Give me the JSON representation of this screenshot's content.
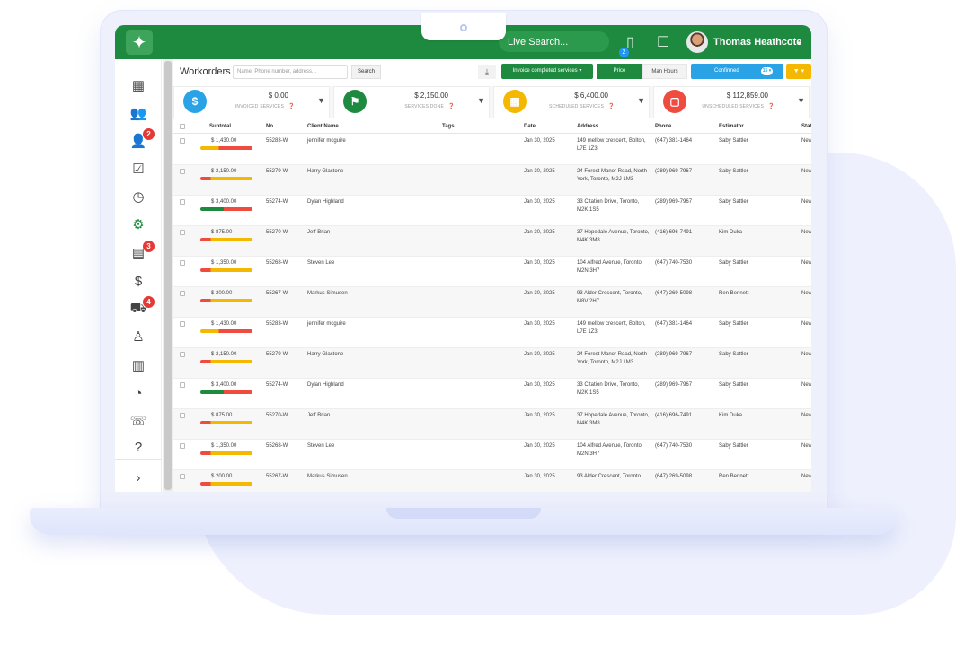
{
  "app": {
    "user_name": "Thomas Heathcote",
    "live_search_placeholder": "Live Search...",
    "phone_badge": "2",
    "colors": {
      "brand": "#1e8a3f",
      "accent_blue": "#29a3e6",
      "accent_yellow": "#f5b800",
      "badge_red": "#e53935"
    }
  },
  "sidebar": {
    "items": [
      {
        "name": "dashboard-icon",
        "glyph": "▦",
        "badge": ""
      },
      {
        "name": "users-icon",
        "glyph": "👥",
        "badge": ""
      },
      {
        "name": "add-user-icon",
        "glyph": "👤",
        "badge": "2"
      },
      {
        "name": "task-check-icon",
        "glyph": "☑",
        "badge": ""
      },
      {
        "name": "clock-icon",
        "glyph": "◷",
        "badge": ""
      },
      {
        "name": "gear-icon",
        "glyph": "⚙",
        "badge": ""
      },
      {
        "name": "calendar-icon",
        "glyph": "▤",
        "badge": "3"
      },
      {
        "name": "dollar-icon",
        "glyph": "$",
        "badge": ""
      },
      {
        "name": "truck-icon",
        "glyph": "⛟",
        "badge": "4"
      },
      {
        "name": "person-icon",
        "glyph": "♙",
        "badge": ""
      },
      {
        "name": "table-icon",
        "glyph": "▥",
        "badge": ""
      },
      {
        "name": "pie-chart-icon",
        "glyph": "◔",
        "badge": ""
      },
      {
        "name": "phone-icon",
        "glyph": "☏",
        "badge": ""
      },
      {
        "name": "help-icon",
        "glyph": "?",
        "badge": ""
      },
      {
        "name": "expand-chevron-icon",
        "glyph": "›",
        "badge": ""
      }
    ]
  },
  "toolbar": {
    "title": "Workorders",
    "search_placeholder": "Name, Phone number, address...",
    "search_label": "Search",
    "status_filter": "Invoice completed services ▾",
    "price_label": "Price",
    "hours_label": "Man Hours",
    "confirmed_label": "Confirmed",
    "confirmed_count": "15 ▾",
    "filter_label": "▼ ▾"
  },
  "summary": [
    {
      "amount": "$ 0.00",
      "label": "INVOICED SERVICES",
      "icon": "dollar-icon",
      "glyph": "$",
      "color": "#29a3e6"
    },
    {
      "amount": "$ 2,150.00",
      "label": "SERVICES DONE",
      "icon": "flag-icon",
      "glyph": "⚑",
      "color": "#1e8a3f"
    },
    {
      "amount": "$ 6,400.00",
      "label": "SCHEDULED SERVICES",
      "icon": "calendar-icon",
      "glyph": "▦",
      "color": "#f5b800"
    },
    {
      "amount": "$ 112,859.00",
      "label": "UNSCHEDULED SERVICES",
      "icon": "calendar-x-icon",
      "glyph": "▢",
      "color": "#ef4b3f"
    }
  ],
  "table": {
    "columns": [
      "Subtotal",
      "No",
      "Client Name",
      "Tags",
      "Date",
      "Address",
      "Phone",
      "Estimator",
      "Status"
    ],
    "rows": [
      {
        "subtotal": "$ 1,430.00",
        "no": "55283-W",
        "client": "jennifer mcguire",
        "date": "Jan 30, 2025",
        "address": "149 mellow crescent, Bolton, L7E 1Z3",
        "phone": "(647) 381-1464",
        "estimator": "Saby Sattler",
        "status": "New",
        "bar": "red"
      },
      {
        "subtotal": "$ 2,150.00",
        "no": "55279-W",
        "client": "Harry Glastone",
        "date": "Jan 30, 2025",
        "address": "24 Forest Manor Road, North York, Toronto, M2J 1M3",
        "phone": "(289) 969-7967",
        "estimator": "Saby Sattler",
        "status": "New",
        "bar": "yellow"
      },
      {
        "subtotal": "$ 3,400.00",
        "no": "55274-W",
        "client": "Dylan Highland",
        "date": "Jan 30, 2025",
        "address": "33 Citation Drive, Toronto, M2K 1S5",
        "phone": "(289) 969-7967",
        "estimator": "Saby Sattler",
        "status": "New",
        "bar": "green"
      },
      {
        "subtotal": "$ 875.00",
        "no": "55270-W",
        "client": "Jeff Brian",
        "date": "Jan 30, 2025",
        "address": "37 Hopedale Avenue, Toronto, M4K 3M8",
        "phone": "(416) 696-7491",
        "estimator": "Kim Duka",
        "status": "New",
        "bar": "yellow"
      },
      {
        "subtotal": "$ 1,350.00",
        "no": "55268-W",
        "client": "Steven Lee",
        "date": "Jan 30, 2025",
        "address": "104 Alfred Avenue, Toronto, M2N 3H7",
        "phone": "(647) 740-7530",
        "estimator": "Saby Sattler",
        "status": "New",
        "bar": "yellow"
      },
      {
        "subtotal": "$ 200.00",
        "no": "55267-W",
        "client": "Markus Simusen",
        "date": "Jan 30, 2025",
        "address": "93 Alder Crescent, Toronto, M8V 2H7",
        "phone": "(647) 269-5098",
        "estimator": "Ren Bennett",
        "status": "New",
        "bar": "yellow"
      },
      {
        "subtotal": "$ 1,430.00",
        "no": "55283-W",
        "client": "jennifer mcguire",
        "date": "Jan 30, 2025",
        "address": "149 mellow crescent, Bolton, L7E 1Z3",
        "phone": "(647) 381-1464",
        "estimator": "Saby Sattler",
        "status": "New",
        "bar": "red"
      },
      {
        "subtotal": "$ 2,150.00",
        "no": "55279-W",
        "client": "Harry Glastone",
        "date": "Jan 30, 2025",
        "address": "24 Forest Manor Road, North York, Toronto, M2J 1M3",
        "phone": "(289) 969-7967",
        "estimator": "Saby Sattler",
        "status": "New",
        "bar": "yellow"
      },
      {
        "subtotal": "$ 3,400.00",
        "no": "55274-W",
        "client": "Dylan Highland",
        "date": "Jan 30, 2025",
        "address": "33 Citation Drive, Toronto, M2K 1S5",
        "phone": "(289) 969-7967",
        "estimator": "Saby Sattler",
        "status": "New",
        "bar": "green"
      },
      {
        "subtotal": "$ 875.00",
        "no": "55270-W",
        "client": "Jeff Brian",
        "date": "Jan 30, 2025",
        "address": "37 Hopedale Avenue, Toronto, M4K 3M8",
        "phone": "(416) 696-7491",
        "estimator": "Kim Duka",
        "status": "New",
        "bar": "yellow"
      },
      {
        "subtotal": "$ 1,350.00",
        "no": "55268-W",
        "client": "Steven Lee",
        "date": "Jan 30, 2025",
        "address": "104 Alfred Avenue, Toronto, M2N 3H7",
        "phone": "(647) 740-7530",
        "estimator": "Saby Sattler",
        "status": "New",
        "bar": "yellow"
      },
      {
        "subtotal": "$ 200.00",
        "no": "55267-W",
        "client": "Markus Simusen",
        "date": "Jan 30, 2025",
        "address": "93 Alder Crescent, Toronto",
        "phone": "(647) 269-5098",
        "estimator": "Ren Bennett",
        "status": "New",
        "bar": "yellow"
      }
    ]
  }
}
